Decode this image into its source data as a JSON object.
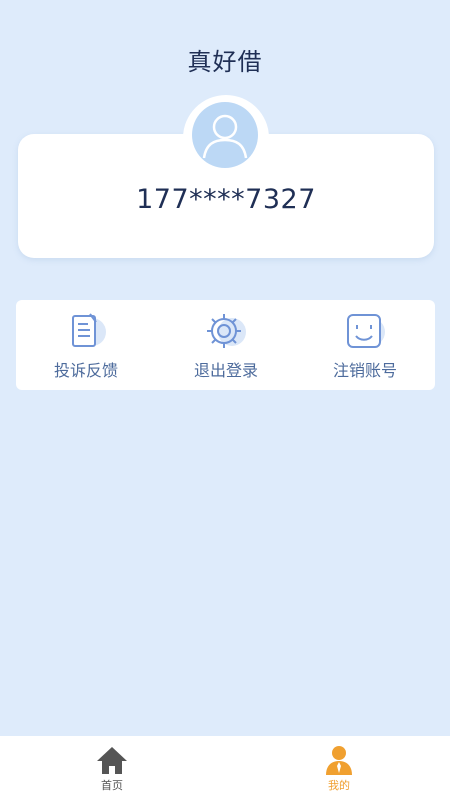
{
  "header": {
    "title": "真好借"
  },
  "profile": {
    "phone": "177****7327"
  },
  "menu": {
    "items": [
      {
        "label": "投诉反馈",
        "icon": "document-edit-icon"
      },
      {
        "label": "退出登录",
        "icon": "gear-icon"
      },
      {
        "label": "注销账号",
        "icon": "smiley-icon"
      }
    ]
  },
  "bottom_nav": {
    "items": [
      {
        "label": "首页",
        "icon": "home-icon",
        "active": false
      },
      {
        "label": "我的",
        "icon": "person-icon",
        "active": true
      }
    ]
  },
  "colors": {
    "background": "#deebfb",
    "title": "#1f2f55",
    "menu_label": "#4d6b9c",
    "icon_blue": "#6f93d6",
    "nav_inactive": "#555555",
    "nav_active": "#f0a030"
  }
}
